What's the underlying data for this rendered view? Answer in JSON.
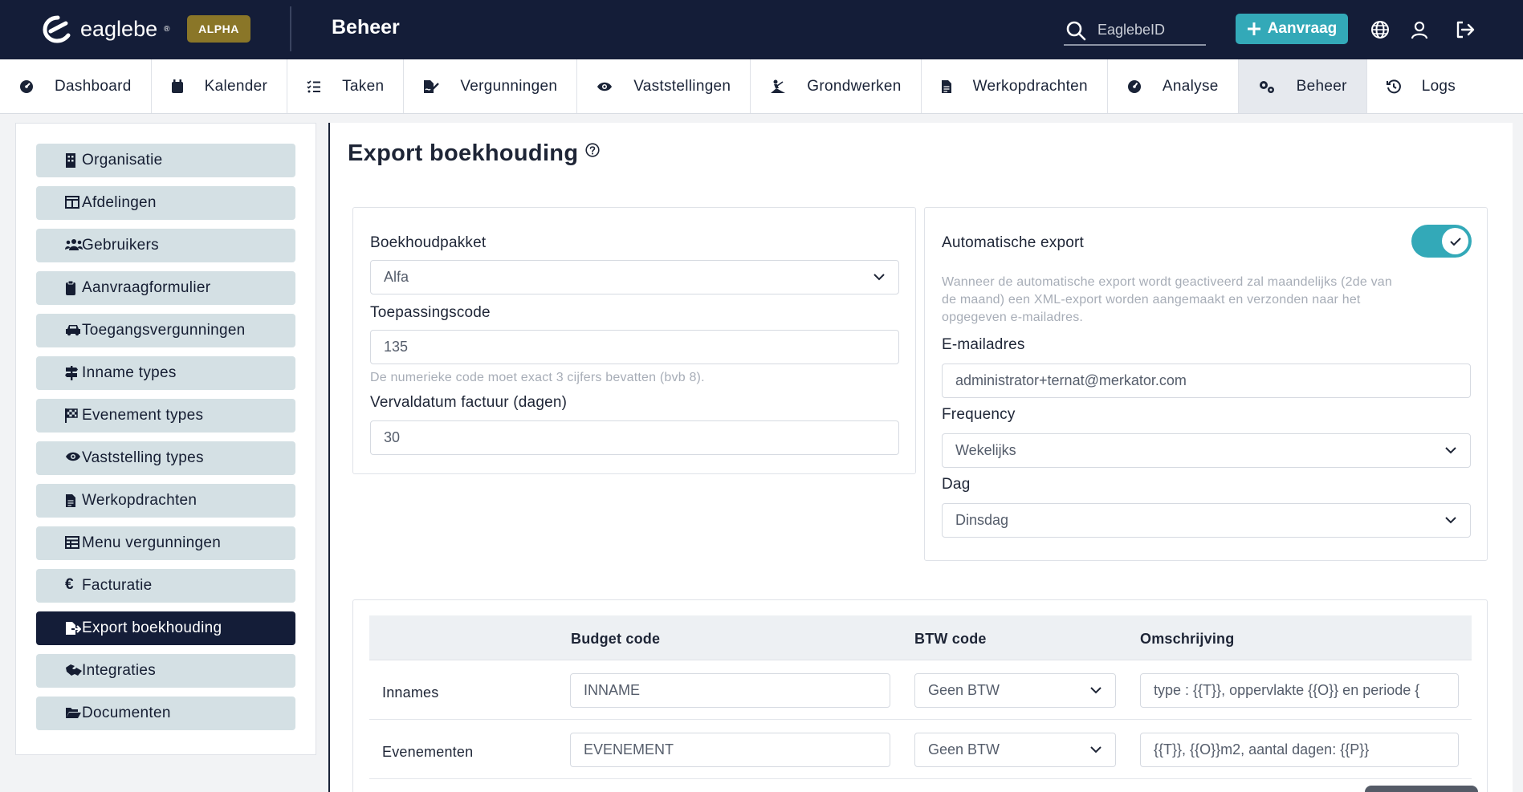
{
  "topbar": {
    "logo_text": "eaglebe",
    "logo_mark": "®",
    "badge": "ALPHA",
    "title": "Beheer",
    "search_placeholder": "EaglebeID",
    "aanvraag_label": "Aanvraag"
  },
  "nav": {
    "items": [
      {
        "label": "Dashboard",
        "icon": "dashboard-gauge-icon"
      },
      {
        "label": "Kalender",
        "icon": "calendar-icon"
      },
      {
        "label": "Taken",
        "icon": "task-list-icon"
      },
      {
        "label": "Vergunningen",
        "icon": "file-signature-icon"
      },
      {
        "label": "Vaststellingen",
        "icon": "eye-icon"
      },
      {
        "label": "Grondwerken",
        "icon": "digging-worker-icon"
      },
      {
        "label": "Werkopdrachten",
        "icon": "document-icon"
      },
      {
        "label": "Analyse",
        "icon": "gauge-icon"
      },
      {
        "label": "Beheer",
        "icon": "gears-icon"
      },
      {
        "label": "Logs",
        "icon": "history-icon"
      }
    ],
    "active": "Beheer"
  },
  "sidebar": {
    "items": [
      {
        "label": "Organisatie"
      },
      {
        "label": "Afdelingen"
      },
      {
        "label": "Gebruikers"
      },
      {
        "label": "Aanvraagformulier"
      },
      {
        "label": "Toegangsvergunningen"
      },
      {
        "label": "Inname types"
      },
      {
        "label": "Evenement types"
      },
      {
        "label": "Vaststelling types"
      },
      {
        "label": "Werkopdrachten"
      },
      {
        "label": "Menu vergunningen"
      },
      {
        "label": "Facturatie"
      },
      {
        "label": "Export boekhouding"
      },
      {
        "label": "Integraties"
      },
      {
        "label": "Documenten"
      }
    ],
    "active": "Export boekhouding",
    "facturatie_symbol": "€"
  },
  "main": {
    "title": "Export boekhouding",
    "left_card": {
      "boekhoudpakket_label": "Boekhoudpakket",
      "boekhoudpakket_value": "Alfa",
      "toepassingscode_label": "Toepassingscode",
      "toepassingscode_value": "135",
      "toepassingscode_hint": "De numerieke code moet exact 3 cijfers bevatten (bvb 8).",
      "vervaldatum_label": "Vervaldatum factuur (dagen)",
      "vervaldatum_value": "30"
    },
    "right_card": {
      "auto_export_label": "Automatische export",
      "auto_export_enabled": true,
      "auto_export_hint_1": "Wanneer de automatische export wordt geactiveerd zal maandelijks (2de van",
      "auto_export_hint_2": "de maand) een XML-export worden aangemaakt en verzonden naar het",
      "auto_export_hint_3": "opgegeven e-mailadres.",
      "email_label": "E-mailadres",
      "email_value": "administrator+ternat@merkator.com",
      "frequency_label": "Frequency",
      "frequency_value": "Wekelijks",
      "dag_label": "Dag",
      "dag_value": "Dinsdag"
    },
    "table": {
      "headers": [
        "",
        "Budget code",
        "BTW code",
        "Omschrijving"
      ],
      "rows": [
        {
          "name": "Innames",
          "budget_code": "INNAME",
          "btw_code": "Geen BTW",
          "omschrijving": "type : {{T}}, oppervlakte {{O}} en periode {"
        },
        {
          "name": "Evenementen",
          "budget_code": "EVENEMENT",
          "btw_code": "Geen BTW",
          "omschrijving": "{{T}}, {{O}}m2, aantal dagen: {{P}}"
        }
      ]
    }
  },
  "colors": {
    "topbar_bg": "#141d38",
    "accent_teal": "#33a9b8",
    "badge_gold": "#8a7628",
    "sidebar_btn": "#d4e0e4"
  }
}
